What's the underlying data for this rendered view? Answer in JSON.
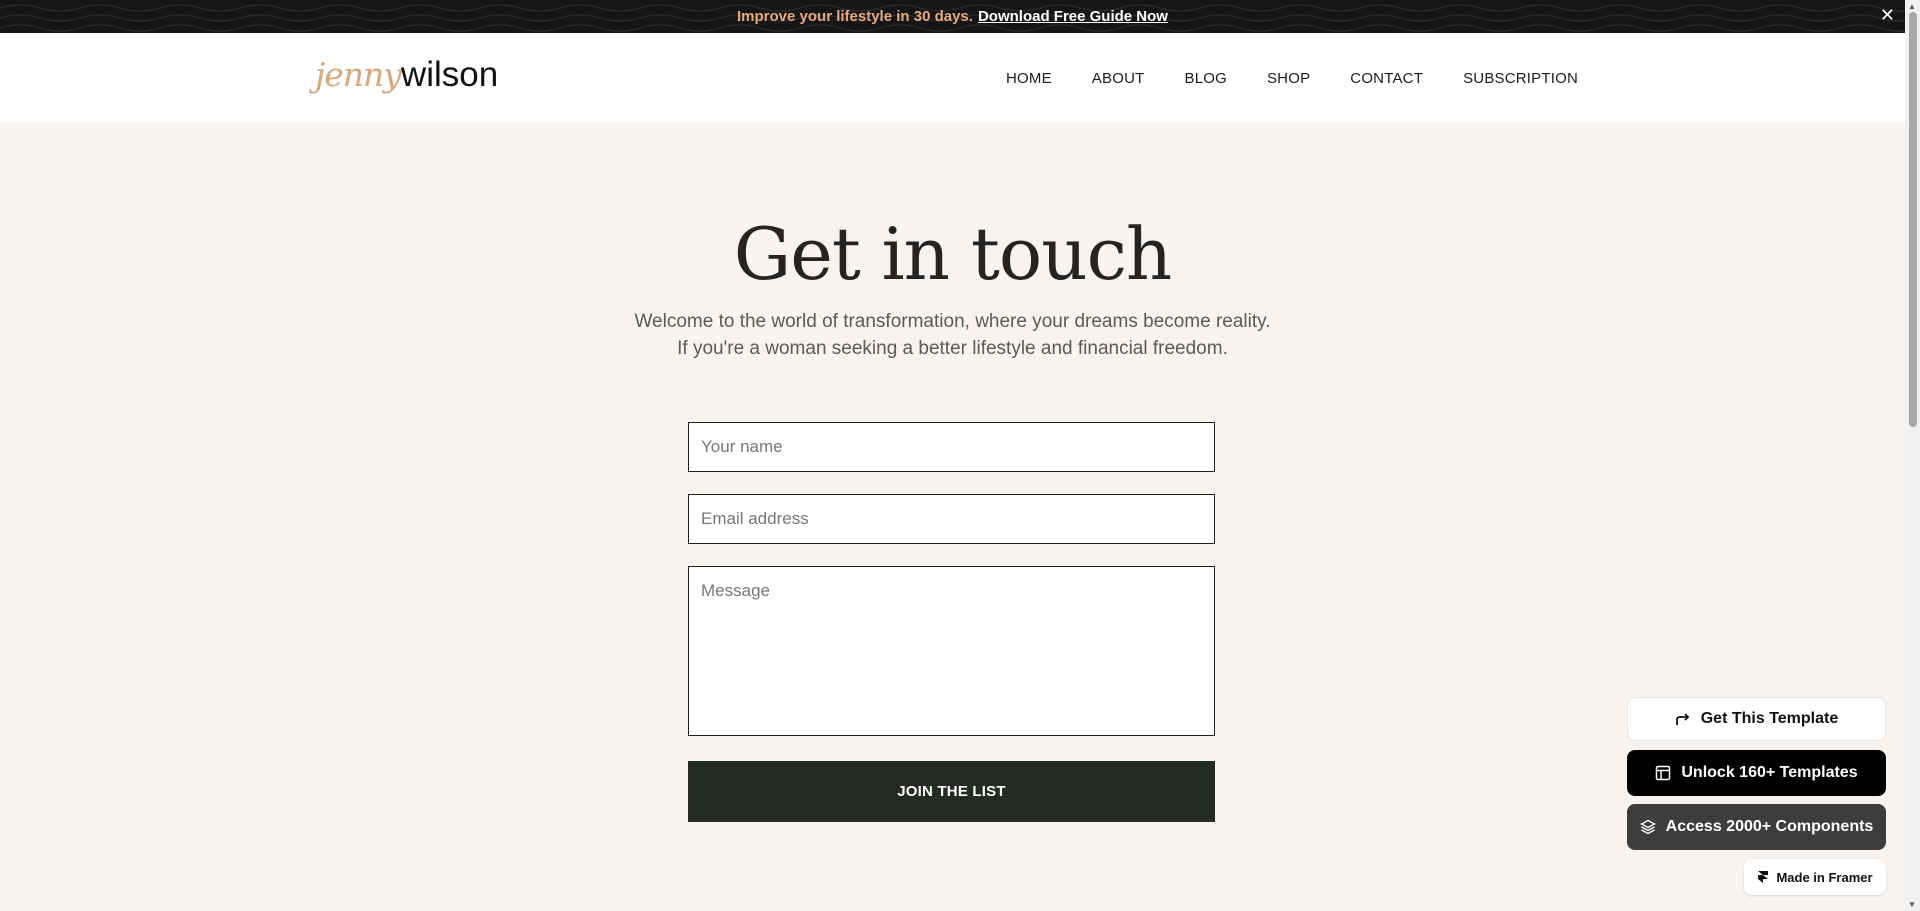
{
  "announcement": {
    "message": "Improve your lifestyle in 30 days.",
    "link_label": "Download Free Guide Now",
    "close_glyph": "✕"
  },
  "brand": {
    "logo_script": "jenny",
    "logo_text": "wilson"
  },
  "nav": {
    "items": [
      {
        "label": "HOME"
      },
      {
        "label": "ABOUT"
      },
      {
        "label": "BLOG"
      },
      {
        "label": "SHOP"
      },
      {
        "label": "CONTACT"
      },
      {
        "label": "SUBSCRIPTION"
      }
    ]
  },
  "hero": {
    "title": "Get in touch",
    "subtitle_line1": "Welcome to the world of transformation, where your dreams become reality.",
    "subtitle_line2": "If you're a woman seeking a better lifestyle and financial freedom."
  },
  "form": {
    "name_placeholder": "Your name",
    "email_placeholder": "Email address",
    "message_placeholder": "Message",
    "submit_label": "JOIN THE LIST"
  },
  "promos": {
    "get_template": "Get This Template",
    "unlock_templates": "Unlock 160+ Templates",
    "access_components": "Access 2000+ Components",
    "made_in_framer": "Made in Framer"
  },
  "colors": {
    "page_bg": "#f8f3ef",
    "accent_orange": "#e7a97e",
    "logo_script": "#d8a77c",
    "dark_button": "#262a25"
  }
}
